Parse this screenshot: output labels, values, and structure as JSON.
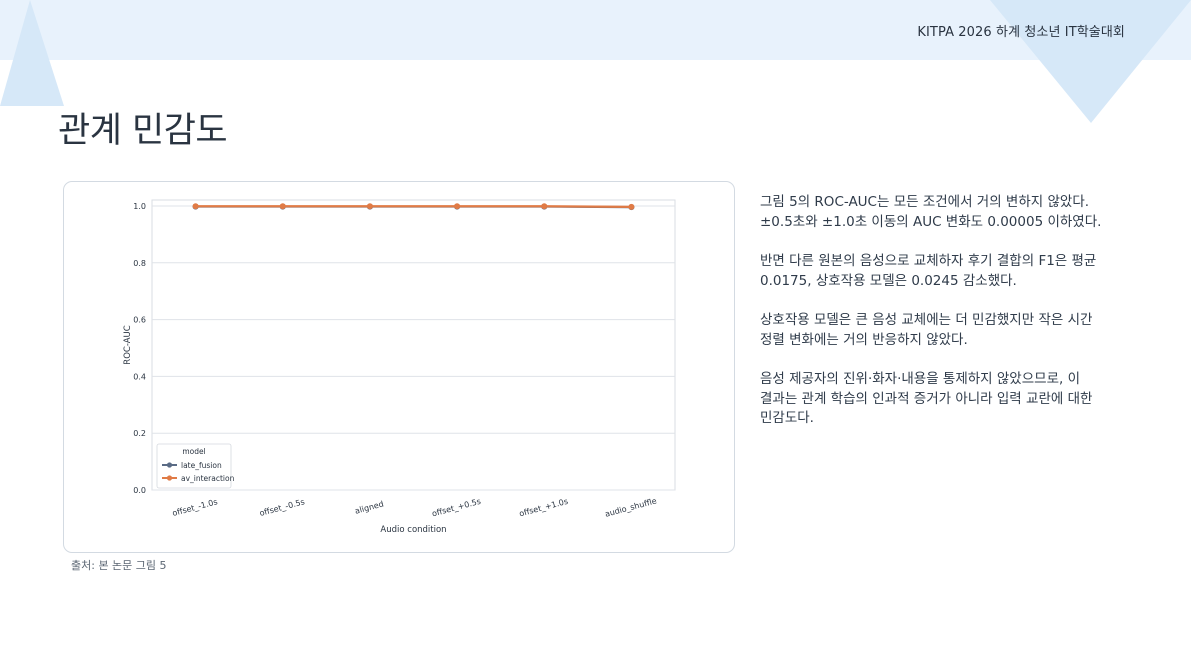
{
  "header": {
    "conference": "KITPA 2026 하계 청소년 IT학술대회"
  },
  "page": {
    "title": "관계 민감도"
  },
  "figure": {
    "source": "출처: 본 논문 그림 5"
  },
  "paragraphs": [
    "그림 5의 ROC-AUC는 모든 조건에서 거의 변하지 않았다. ±0.5초와 ±1.0초 이동의 AUC 변화도 0.00005 이하였다.",
    "반면 다른 원본의 음성으로 교체하자 후기 결합의 F1은 평균 0.0175, 상호작용 모델은 0.0245 감소했다.",
    "상호작용 모델은 큰 음성 교체에는 더 민감했지만 작은 시간 정렬 변화에는 거의 반응하지 않았다.",
    "음성 제공자의 진위·화자·내용을 통제하지 않았으므로, 이 결과는 관계 학습의 인과적 증거가 아니라 입력 교란에 대한 민감도다."
  ],
  "colors": {
    "band": "#e8f2fc",
    "triangle": "#d6e8f8",
    "late_fusion": "#5a6b85",
    "av_interaction": "#e07b46"
  },
  "chart_data": {
    "type": "line",
    "xlabel": "Audio condition",
    "ylabel": "ROC-AUC",
    "categories": [
      "offset_-1.0s",
      "offset_-0.5s",
      "aligned",
      "offset_+0.5s",
      "offset_+1.0s",
      "audio_shuffle"
    ],
    "ylim": [
      0.0,
      1.0
    ],
    "yticks": [
      "0.0",
      "0.2",
      "0.4",
      "0.6",
      "0.8",
      "1.0"
    ],
    "grid": true,
    "legend_title": "model",
    "legend_position": "bottom-left",
    "series": [
      {
        "name": "late_fusion",
        "color": "#5a6b85",
        "values": [
          0.998,
          0.998,
          0.998,
          0.998,
          0.998,
          0.996
        ]
      },
      {
        "name": "av_interaction",
        "color": "#e07b46",
        "values": [
          0.999,
          0.999,
          0.999,
          0.999,
          0.999,
          0.997
        ]
      }
    ]
  }
}
